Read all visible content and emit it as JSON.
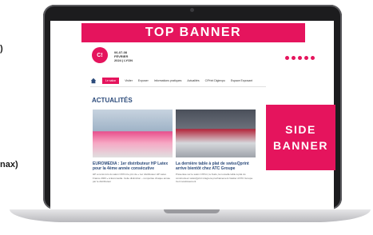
{
  "edge_text": {
    "item_a": ")",
    "item_b": "nax)"
  },
  "banners": {
    "top": "TOP BANNER",
    "side_line1": "SIDE",
    "side_line2": "BANNER"
  },
  "site": {
    "logo_text": "C!",
    "dates_line1": "06-07-08",
    "dates_line2": "FÉVRIER",
    "dates_line3": "2024 | LYON",
    "nav": [
      "Le salon",
      "Visiter",
      "Exposer",
      "Informations pratiques",
      "Actualités",
      "C!Print Digiexpo",
      "Espace Exposant"
    ],
    "section_title": "ACTUALITÉS",
    "articles": [
      {
        "title": "EUROMEDIA : 1er distributeur HP Latex pour la 4ème année consécutive",
        "body": "HP a remis lors du salon C!Print le prix de « 1er distributeur HP Latex France 2023 » à Euromedia. Cette distinction – remportée chaque année par le distributeur"
      },
      {
        "title": "La dernière table à plat de swissQprint arrive bientôt chez ATC Groupe",
        "body": "Présentée sur le salon C!Print, la Kudu, la nouvelle table à plat du constructeur swissQprint intègrera prochainement l'atelier d'ATC Groupe. Cet investissement"
      }
    ]
  },
  "colors": {
    "accent": "#e5145d",
    "title_blue": "#2b4a7a"
  }
}
